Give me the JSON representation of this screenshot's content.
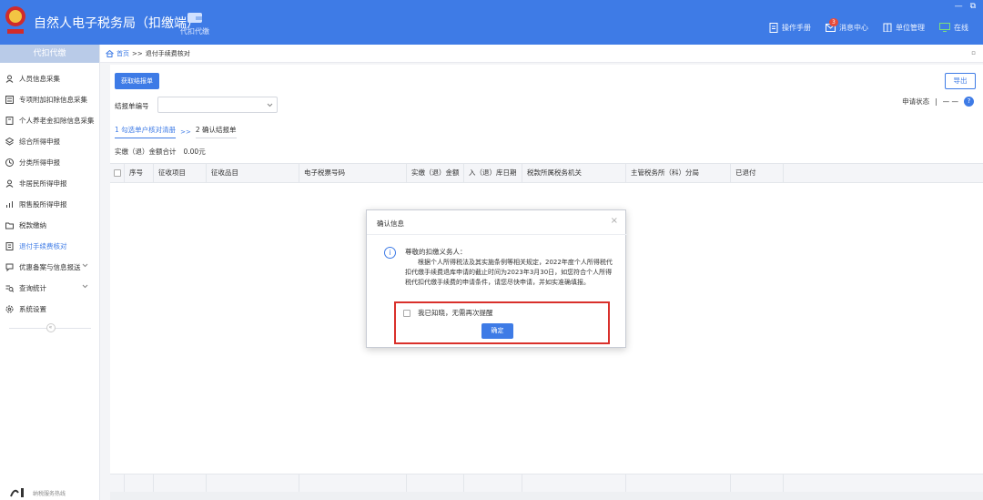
{
  "header": {
    "app_title": "自然人电子税务局（扣缴端）",
    "module_label": "代扣代缴",
    "right_items": [
      {
        "label": "操作手册",
        "icon": "document-icon"
      },
      {
        "label": "消息中心",
        "icon": "mail-icon",
        "badge": "3"
      },
      {
        "label": "单位管理",
        "icon": "building-icon"
      },
      {
        "label": "在线",
        "icon": "monitor-icon"
      }
    ],
    "window_controls": [
      "—",
      "⧉"
    ]
  },
  "sidebar": {
    "title": "代扣代缴",
    "items": [
      {
        "label": "人员信息采集",
        "icon": "person-icon",
        "active": false,
        "expandable": false
      },
      {
        "label": "专项附加扣除信息采集",
        "icon": "list-icon",
        "active": false,
        "expandable": false
      },
      {
        "label": "个人养老金扣除信息采集",
        "icon": "doc-icon",
        "active": false,
        "expandable": false
      },
      {
        "label": "综合所得申报",
        "icon": "layers-icon",
        "active": false,
        "expandable": false
      },
      {
        "label": "分类所得申报",
        "icon": "clock-icon",
        "active": false,
        "expandable": false
      },
      {
        "label": "非居民所得申报",
        "icon": "user-icon",
        "active": false,
        "expandable": false
      },
      {
        "label": "限售股所得申报",
        "icon": "chart-icon",
        "active": false,
        "expandable": false
      },
      {
        "label": "税款缴纳",
        "icon": "folder-icon",
        "active": false,
        "expandable": false
      },
      {
        "label": "退付手续费核对",
        "icon": "check-doc-icon",
        "active": true,
        "expandable": false
      },
      {
        "label": "优惠备案与信息报送",
        "icon": "bubble-icon",
        "active": false,
        "expandable": true
      },
      {
        "label": "查询统计",
        "icon": "search-list-icon",
        "active": false,
        "expandable": true
      },
      {
        "label": "系统设置",
        "icon": "gear-icon",
        "active": false,
        "expandable": false
      }
    ],
    "collapse_symbol": "«",
    "footer_text": "纳税服务热线"
  },
  "breadcrumb": {
    "home": "首页",
    "separator": ">>",
    "current": "退付手续费核对",
    "close_symbol": "▫"
  },
  "toolbar": {
    "fetch_label": "获取结报单",
    "export_label": "导出"
  },
  "form": {
    "report_no_label": "结报单编号",
    "report_no_value": "",
    "status_label": "申请状态",
    "status_separator": "|",
    "status_value": "— —",
    "help_symbol": "?"
  },
  "steps": {
    "step1": "1 勾选单户核对清册",
    "arrow": ">>",
    "step2": "2 确认结报单"
  },
  "summary": {
    "label": "实缴（退）金额合计",
    "value": "0.00元"
  },
  "table": {
    "columns": [
      "序号",
      "征收项目",
      "征收品目",
      "电子税票号码",
      "实缴（退）金额",
      "入（退）库日期",
      "税款所属税务机关",
      "主管税务所（科）分局",
      "已退付"
    ]
  },
  "dialog": {
    "title": "确认信息",
    "close_symbol": "×",
    "info_symbol": "i",
    "greeting": "尊敬的扣缴义务人：",
    "body": "根据个人所得税法及其实施条例等相关规定，2022年度个人所得税代扣代缴手续费退库申请的截止时间为2023年3月30日，如您符合个人所得税代扣代缴手续费的申请条件，请您尽快申请，并如实准确填报。",
    "ack_label": "我已知晓，无需再次提醒",
    "ack_checked": false,
    "ok_label": "确定"
  },
  "colors": {
    "primary": "#3e7be6",
    "highlight_border": "#d9302b",
    "sidebar_header": "#b9cbe8"
  }
}
